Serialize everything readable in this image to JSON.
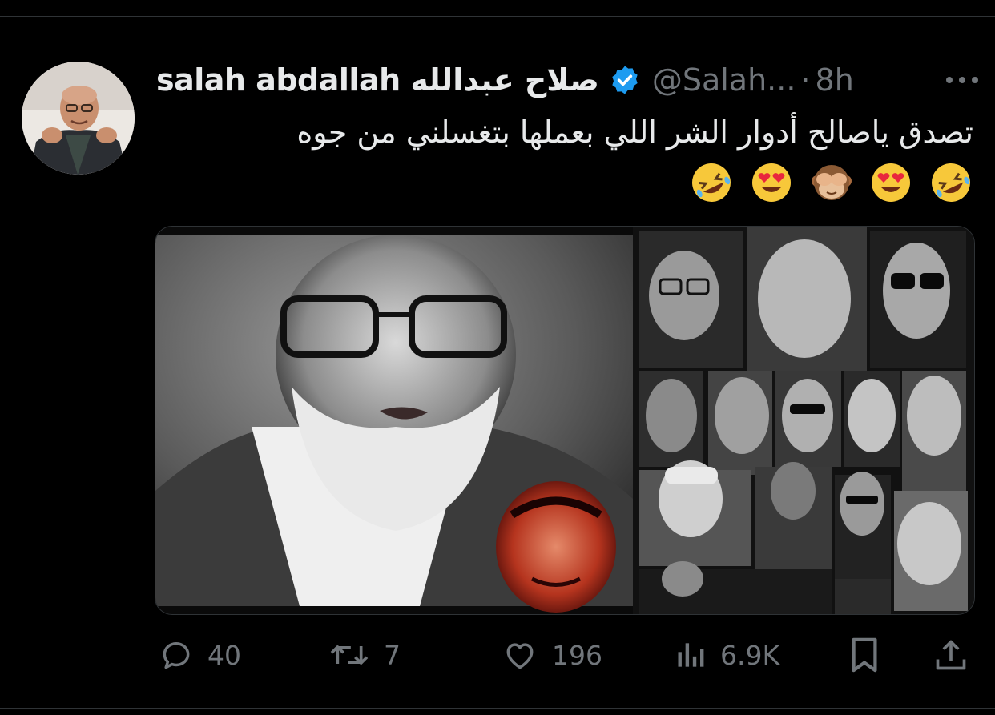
{
  "tweet": {
    "author": {
      "display_name": "salah abdallah صلاح عبدالله",
      "handle": "@Salah...",
      "verified": true,
      "avatar_icon": "profile-photo"
    },
    "separator": "·",
    "time": "8h",
    "text_line1": "تصدق ياصالح أدوار الشر اللي بعملها بتغسلني من جوه",
    "emojis": [
      "🤣",
      "😍",
      "🙈",
      "😍",
      "🤣"
    ],
    "media": {
      "type": "photo-collage",
      "description_icon": "image"
    }
  },
  "actions": {
    "reply": {
      "icon": "reply-icon",
      "count": "40"
    },
    "retweet": {
      "icon": "retweet-icon",
      "count": "7"
    },
    "like": {
      "icon": "heart-icon",
      "count": "196"
    },
    "views": {
      "icon": "views-icon",
      "count": "6.9K"
    },
    "bookmark": {
      "icon": "bookmark-icon"
    },
    "share": {
      "icon": "share-icon"
    }
  },
  "colors": {
    "background": "#000000",
    "text_primary": "#e7e9ea",
    "text_secondary": "#71767b",
    "verified_blue": "#1d9bf0",
    "border": "#2f3336"
  }
}
